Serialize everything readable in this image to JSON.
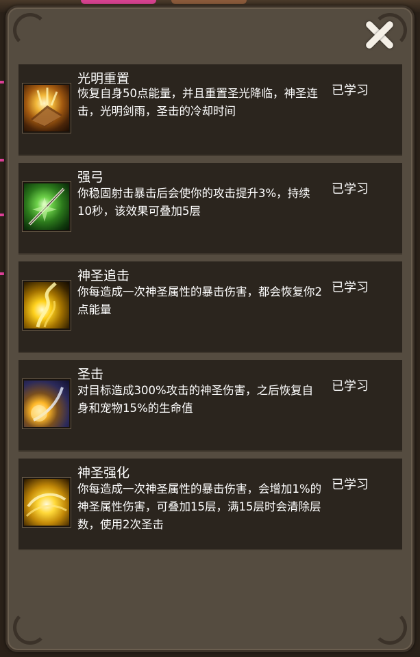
{
  "panel": {
    "close_icon": "close-x-icon"
  },
  "skills": [
    {
      "name": "光明重置",
      "description": "恢复自身50点能量，并且重置圣光降临，神圣连击，光明剑雨，圣击的冷却时间",
      "status": "已学习",
      "icon": "light-reset-icon"
    },
    {
      "name": "强弓",
      "description": "你稳固射击暴击后会使你的攻击提升3%，持续10秒，该效果可叠加5层",
      "status": "已学习",
      "icon": "strong-bow-icon"
    },
    {
      "name": "神圣追击",
      "description": "你每造成一次神圣属性的暴击伤害，都会恢复你2点能量",
      "status": "已学习",
      "icon": "holy-pursuit-icon"
    },
    {
      "name": "圣击",
      "description": "对目标造成300%攻击的神圣伤害，之后恢复自身和宠物15%的生命值",
      "status": "已学习",
      "icon": "holy-strike-icon"
    },
    {
      "name": "神圣强化",
      "description": "你每造成一次神圣属性的暴击伤害，会增加1%的神圣属性伤害，可叠加15层，满15层时会清除层数，使用2次圣击",
      "status": "已学习",
      "icon": "holy-empower-icon"
    }
  ]
}
